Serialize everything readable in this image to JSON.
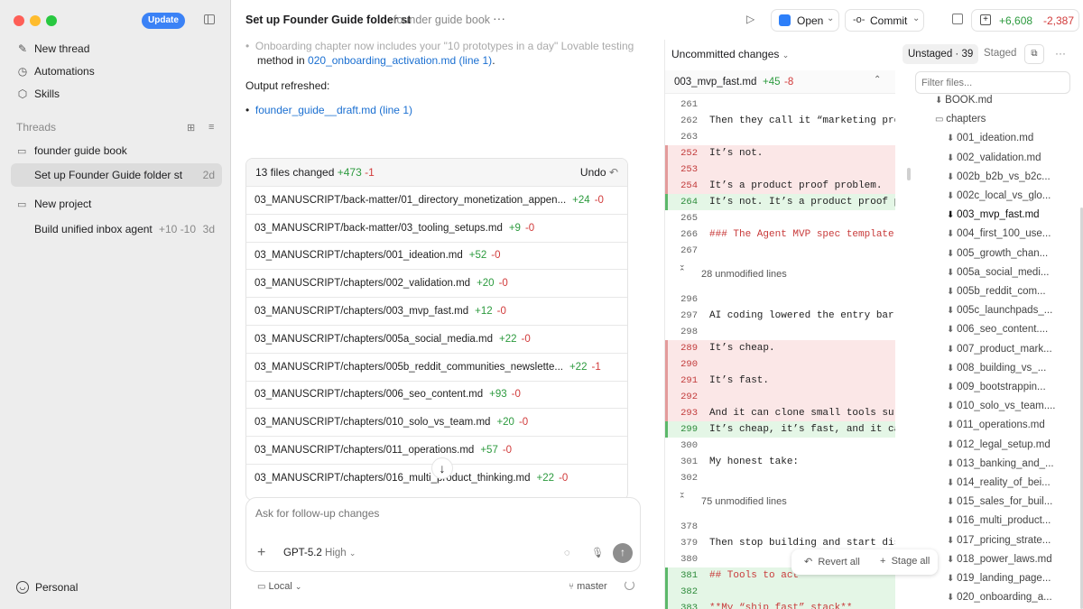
{
  "sidebar": {
    "update_label": "Update",
    "nav": [
      {
        "label": "New thread",
        "icon": "compose-icon"
      },
      {
        "label": "Automations",
        "icon": "clock-icon"
      },
      {
        "label": "Skills",
        "icon": "cube-icon"
      }
    ],
    "threads_header": "Threads",
    "threads": [
      {
        "label": "founder guide book",
        "kind": "folder"
      },
      {
        "label": "Set up Founder Guide folder st",
        "date": "2d",
        "selected": true
      },
      {
        "label": "New project",
        "kind": "folder"
      },
      {
        "label": "Build unified inbox agent",
        "diff": "+10 -10",
        "date": "3d"
      }
    ],
    "account": "Personal"
  },
  "topbar": {
    "title": "Set up Founder Guide folder st",
    "project": "founder guide book",
    "open_label": "Open",
    "commit_label": "Commit",
    "additions": "+6,608",
    "deletions": "-2,387"
  },
  "main": {
    "partial_bullet": "Onboarding chapter now includes your \"10 prototypes in a day\" Lovable testing",
    "method_prefix": "method in ",
    "method_link": "020_onboarding_activation.md (line 1)",
    "method_suffix": ".",
    "output_text": "Output refreshed:",
    "output_link": "founder_guide__draft.md (line 1)",
    "changes": {
      "summary": "13 files changed",
      "add": "+473",
      "del": "-1",
      "undo_label": "Undo",
      "files": [
        {
          "path": "03_MANUSCRIPT/back-matter/01_directory_monetization_appen...",
          "add": "+24",
          "del": "-0"
        },
        {
          "path": "03_MANUSCRIPT/back-matter/03_tooling_setups.md",
          "add": "+9",
          "del": "-0"
        },
        {
          "path": "03_MANUSCRIPT/chapters/001_ideation.md",
          "add": "+52",
          "del": "-0"
        },
        {
          "path": "03_MANUSCRIPT/chapters/002_validation.md",
          "add": "+20",
          "del": "-0"
        },
        {
          "path": "03_MANUSCRIPT/chapters/003_mvp_fast.md",
          "add": "+12",
          "del": "-0"
        },
        {
          "path": "03_MANUSCRIPT/chapters/005a_social_media.md",
          "add": "+22",
          "del": "-0"
        },
        {
          "path": "03_MANUSCRIPT/chapters/005b_reddit_communities_newslette...",
          "add": "+22",
          "del": "-1"
        },
        {
          "path": "03_MANUSCRIPT/chapters/006_seo_content.md",
          "add": "+93",
          "del": "-0"
        },
        {
          "path": "03_MANUSCRIPT/chapters/010_solo_vs_team.md",
          "add": "+20",
          "del": "-0"
        },
        {
          "path": "03_MANUSCRIPT/chapters/011_operations.md",
          "add": "+57",
          "del": "-0"
        },
        {
          "path": "03_MANUSCRIPT/chapters/016_multi_product_thinking.md",
          "add": "+22",
          "del": "-0"
        }
      ]
    },
    "composer": {
      "placeholder": "Ask for follow-up changes",
      "model": "GPT-5.2",
      "effort": "High",
      "env": "Local",
      "branch": "master"
    }
  },
  "review": {
    "header": "Uncommitted changes",
    "unstaged": "Unstaged · 39",
    "staged": "Staged",
    "filter_placeholder": "Filter files...",
    "file_name": "003_mvp_fast.md",
    "file_add": "+45",
    "file_del": "-8",
    "lines": [
      {
        "n": "261",
        "t": "",
        "k": "ctx"
      },
      {
        "n": "262",
        "t": "Then they call it “marketing proble",
        "k": "ctx"
      },
      {
        "n": "263",
        "t": "",
        "k": "ctx"
      },
      {
        "n": "252",
        "t": "It’s not.",
        "k": "del"
      },
      {
        "n": "253",
        "t": "",
        "k": "del"
      },
      {
        "n": "254",
        "t": "It’s a product proof problem.",
        "k": "del"
      },
      {
        "n": "264",
        "t": "It’s not. It’s a product proof prob",
        "k": "add"
      },
      {
        "n": "265",
        "t": "",
        "k": "ctx"
      },
      {
        "n": "266",
        "t": "### The Agent MVP spec template (co",
        "k": "ctx",
        "h": true
      },
      {
        "n": "267",
        "t": "",
        "k": "ctx"
      },
      {
        "fold": "28 unmodified lines"
      },
      {
        "n": "296",
        "t": "",
        "k": "ctx"
      },
      {
        "n": "297",
        "t": "AI coding lowered the entry barrie",
        "k": "ctx"
      },
      {
        "n": "298",
        "t": "",
        "k": "ctx"
      },
      {
        "n": "289",
        "t": "It’s cheap.",
        "k": "del"
      },
      {
        "n": "290",
        "t": "",
        "k": "del"
      },
      {
        "n": "291",
        "t": "It’s fast.",
        "k": "del"
      },
      {
        "n": "292",
        "t": "",
        "k": "del"
      },
      {
        "n": "293",
        "t": "And it can clone small tools surpri",
        "k": "del"
      },
      {
        "n": "299",
        "t": "It’s cheap, it’s fast, and it can c",
        "k": "add"
      },
      {
        "n": "300",
        "t": "",
        "k": "ctx"
      },
      {
        "n": "301",
        "t": "My honest take:",
        "k": "ctx"
      },
      {
        "n": "302",
        "t": "",
        "k": "ctx"
      },
      {
        "fold": "75 unmodified lines"
      },
      {
        "n": "378",
        "t": "",
        "k": "ctx"
      },
      {
        "n": "379",
        "t": "Then stop building and start distri",
        "k": "ctx"
      },
      {
        "n": "380",
        "t": "",
        "k": "ctx"
      },
      {
        "n": "381",
        "t": "## Tools to act",
        "k": "add",
        "h": true
      },
      {
        "n": "382",
        "t": "",
        "k": "add"
      },
      {
        "n": "383",
        "t": "**My “ship fast” stack**",
        "k": "add",
        "h": true
      }
    ],
    "tree": [
      {
        "label": "BOOK.md",
        "type": "file",
        "partial": true
      },
      {
        "label": "chapters",
        "type": "folder"
      },
      {
        "label": "001_ideation.md",
        "type": "file"
      },
      {
        "label": "002_validation.md",
        "type": "file"
      },
      {
        "label": "002b_b2b_vs_b2c...",
        "type": "file"
      },
      {
        "label": "002c_local_vs_glo...",
        "type": "file"
      },
      {
        "label": "003_mvp_fast.md",
        "type": "file",
        "active": true
      },
      {
        "label": "004_first_100_use...",
        "type": "file"
      },
      {
        "label": "005_growth_chan...",
        "type": "file"
      },
      {
        "label": "005a_social_medi...",
        "type": "file"
      },
      {
        "label": "005b_reddit_com...",
        "type": "file"
      },
      {
        "label": "005c_launchpads_...",
        "type": "file"
      },
      {
        "label": "006_seo_content....",
        "type": "file"
      },
      {
        "label": "007_product_mark...",
        "type": "file"
      },
      {
        "label": "008_building_vs_...",
        "type": "file"
      },
      {
        "label": "009_bootstrappin...",
        "type": "file"
      },
      {
        "label": "010_solo_vs_team....",
        "type": "file"
      },
      {
        "label": "011_operations.md",
        "type": "file"
      },
      {
        "label": "012_legal_setup.md",
        "type": "file"
      },
      {
        "label": "013_banking_and_...",
        "type": "file"
      },
      {
        "label": "014_reality_of_bei...",
        "type": "file"
      },
      {
        "label": "015_sales_for_buil...",
        "type": "file"
      },
      {
        "label": "016_multi_product...",
        "type": "file"
      },
      {
        "label": "017_pricing_strate...",
        "type": "file"
      },
      {
        "label": "018_power_laws.md",
        "type": "file"
      },
      {
        "label": "019_landing_page...",
        "type": "file"
      },
      {
        "label": "020_onboarding_a...",
        "type": "file"
      }
    ],
    "revert_label": "Revert all",
    "stage_label": "Stage all"
  }
}
